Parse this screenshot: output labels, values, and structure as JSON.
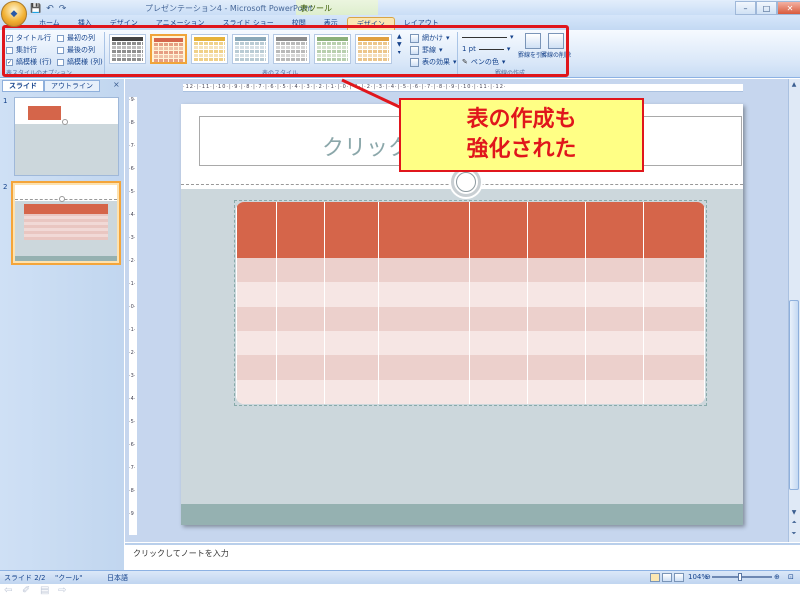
{
  "window": {
    "title": "プレゼンテーション4 - Microsoft PowerPoint",
    "context_title": "表ツール"
  },
  "qat": {
    "save": "💾",
    "undo": "↶",
    "redo": "↷"
  },
  "tabs": [
    "ホーム",
    "挿入",
    "デザイン",
    "アニメーション",
    "スライド ショー",
    "校閲",
    "表示",
    "デザイン",
    "レイアウト"
  ],
  "active_tab_index": 7,
  "ribbon": {
    "style_options": {
      "header_row": "タイトル行",
      "total_row": "集計行",
      "banded_rows": "縞模様 (行)",
      "first_column": "最初の列",
      "last_column": "最後の列",
      "banded_columns": "縞模様 (列)",
      "header_row_checked": "✓",
      "banded_rows_checked": "✓",
      "group_label": "表スタイルのオプション"
    },
    "table_styles": {
      "group_label": "表のスタイル",
      "colors": [
        "#444444",
        "#d5654a",
        "#e6b23a",
        "#8aa8b8",
        "#8c8c8c",
        "#8ab07a",
        "#e0a040",
        "#9ab0d0"
      ]
    },
    "style_buttons": {
      "shading": "網かけ",
      "borders": "罫線",
      "effects": "表の効果"
    },
    "draw_borders": {
      "pen_weight": "1 pt",
      "pen_color": "ペンの色",
      "draw_table": "罫線を引く",
      "eraser": "罫線の削除",
      "group_label": "罫線の作成"
    }
  },
  "left_pane": {
    "tabs": [
      "スライド",
      "アウトライン"
    ],
    "close": "×",
    "slide_numbers": [
      "1",
      "2"
    ]
  },
  "slide": {
    "title_placeholder": "クリックしてタイトルを入力"
  },
  "callout": {
    "line1": "表の作成も",
    "line2": "強化された"
  },
  "ruler": {
    "h": "·12·|·11·|·10·|·9·|·8·|·7·|·6·|·5·|·4·|·3·|·2·|·1·|·0·|·1·|·2·|·3·|·4·|·5·|·6·|·7·|·8·|·9·|·10·|·11·|·12·",
    "v": "·9·|·8·|·7·|·6·|·5·|·4·|·3·|·2·|·1·|·0·|·1·|·2·|·3·|·4·|·5·|·6·|·7·|·8·|·9"
  },
  "notes": {
    "placeholder": "クリックしてノートを入力"
  },
  "status": {
    "slide": "スライド 2/2",
    "theme": "\"クール\"",
    "language": "日本語",
    "zoom": "104%"
  }
}
